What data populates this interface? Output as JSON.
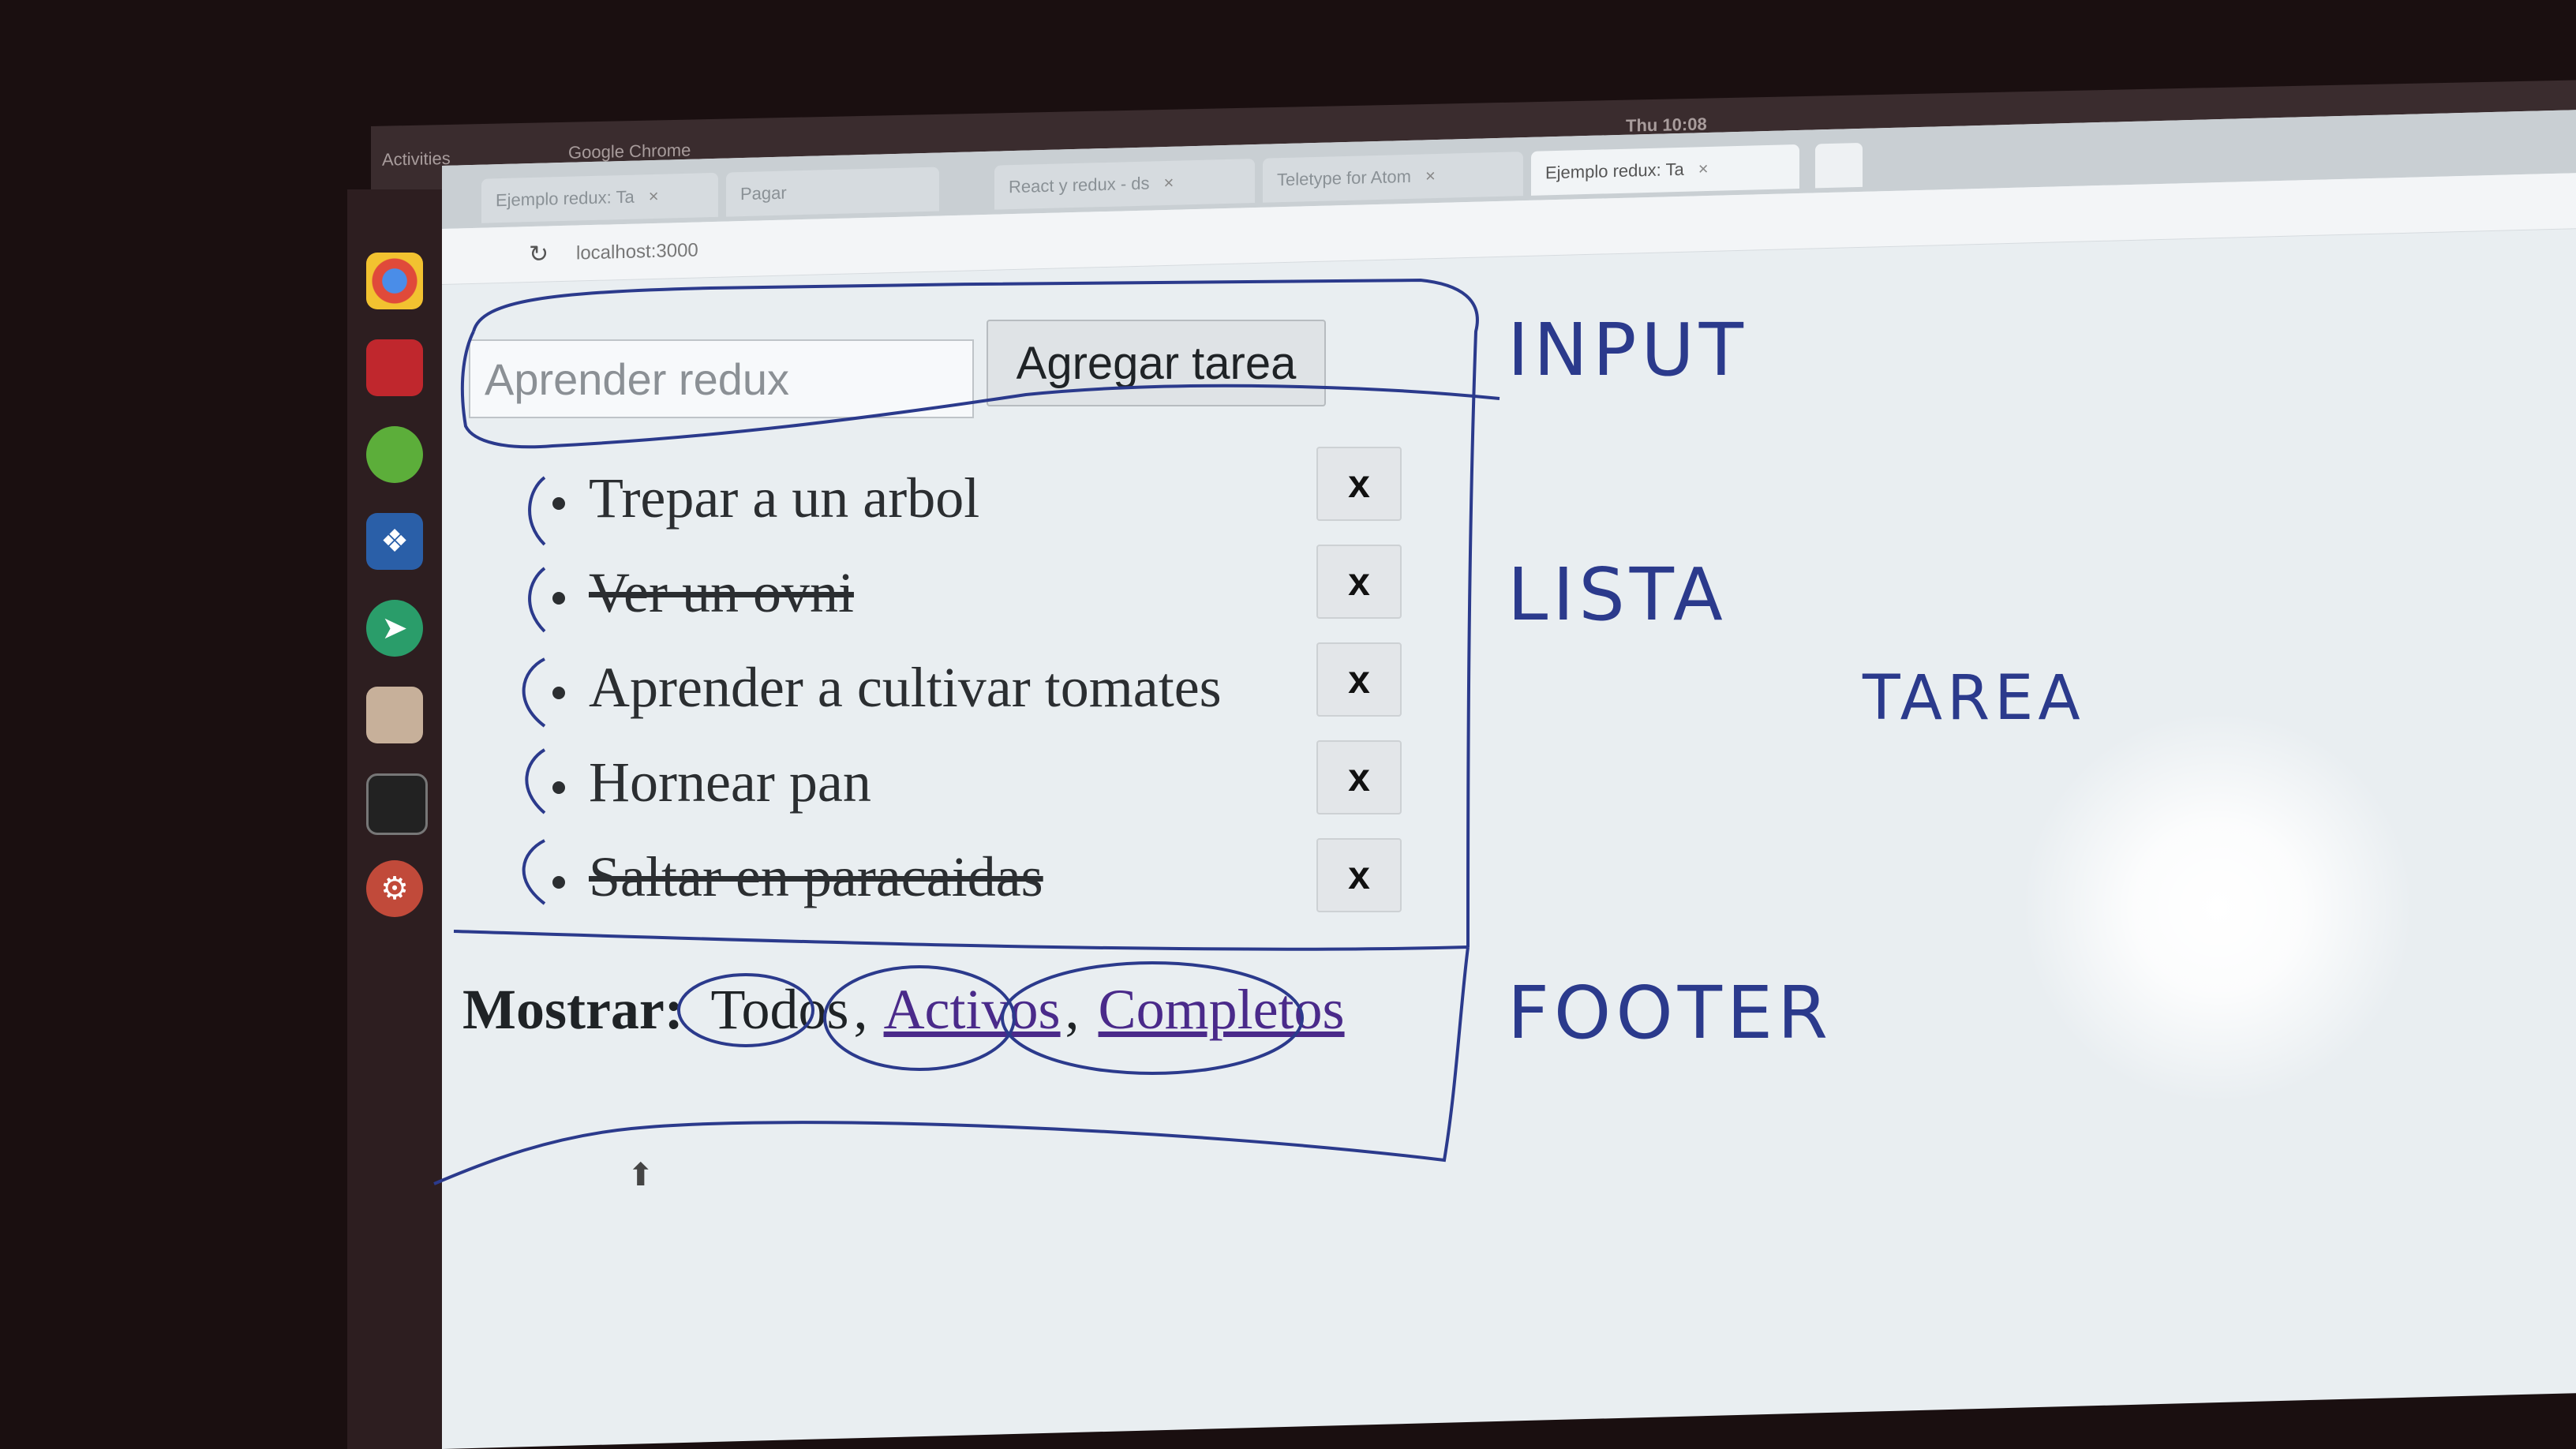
{
  "topbar": {
    "activities": "Activities",
    "app_name": "Google Chrome",
    "clock": "Thu 10:08"
  },
  "browser": {
    "tabs": [
      {
        "label": "Ejemplo redux: Ta",
        "active": false
      },
      {
        "label": "Pagar",
        "active": false
      },
      {
        "label": "React y redux - ds",
        "active": false
      },
      {
        "label": "Teletype for Atom",
        "active": false
      },
      {
        "label": "Ejemplo redux: Ta",
        "active": true
      }
    ],
    "url": "localhost:3000"
  },
  "app": {
    "input_placeholder": "Aprender redux",
    "add_button_label": "Agregar tarea",
    "todos": [
      {
        "text": "Trepar a un arbol",
        "completed": false
      },
      {
        "text": "Ver un ovni",
        "completed": true
      },
      {
        "text": "Aprender a cultivar tomates",
        "completed": false
      },
      {
        "text": "Hornear pan",
        "completed": false
      },
      {
        "text": "Saltar en paracaidas",
        "completed": true
      }
    ],
    "delete_label": "x",
    "footer": {
      "label": "Mostrar:",
      "filters": [
        "Todos",
        "Activos",
        "Completos"
      ],
      "separator": ","
    }
  },
  "whiteboard": {
    "input": "INPUT",
    "lista": "LISTA",
    "tarea": "TAREA",
    "footer": "FOOTER"
  },
  "colors": {
    "link": "#4a2a8a",
    "marker": "#2b3a8c",
    "desktop": "#1a0f10",
    "page": "#e9eef1"
  }
}
